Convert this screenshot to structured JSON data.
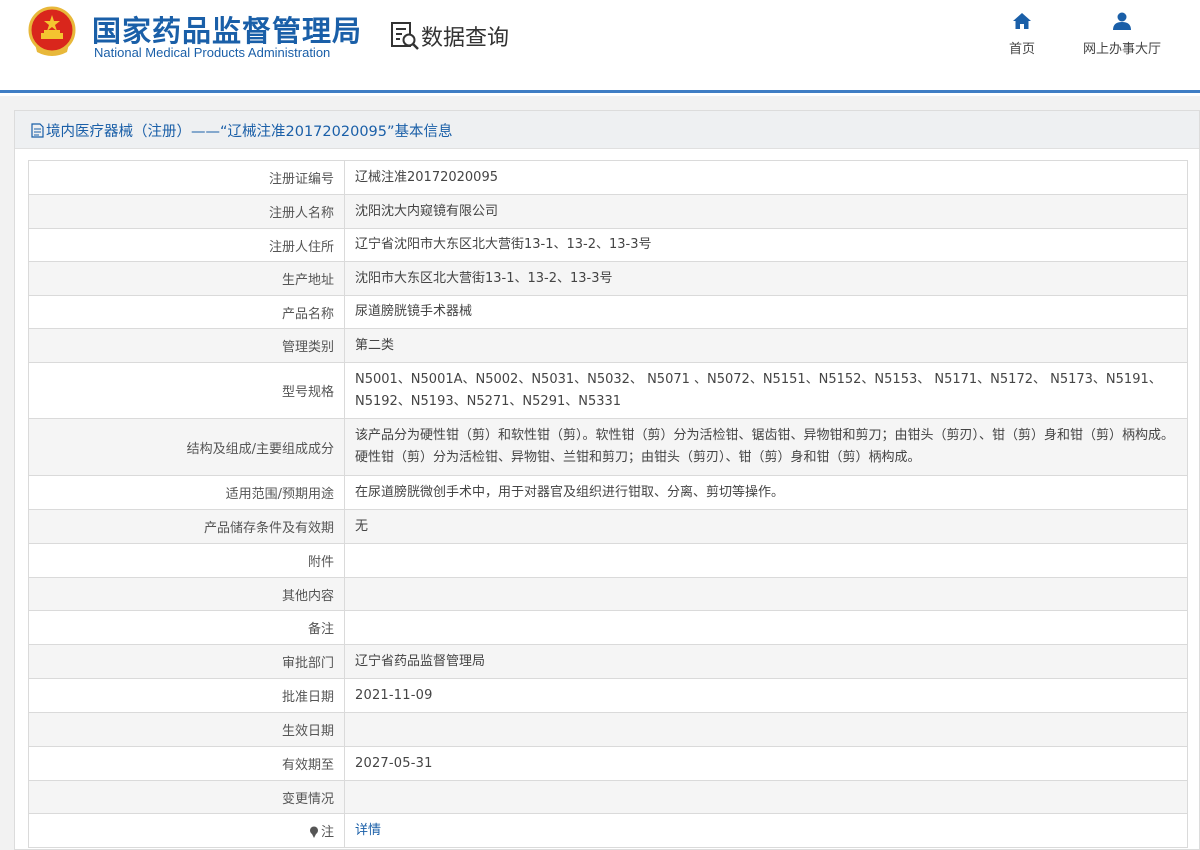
{
  "header": {
    "brand_cn": "国家药品监督管理局",
    "brand_en": "National Medical Products Administration",
    "section_title": "数据查询",
    "nav": [
      {
        "label": "首页",
        "icon": "home-icon"
      },
      {
        "label": "网上办事大厅",
        "icon": "user-icon"
      }
    ]
  },
  "colors": {
    "brand": "#1a5fa8",
    "divider": "#3f7dc4",
    "label_bg": "#fafafa"
  },
  "panel": {
    "title": "境内医疗器械（注册）——“辽械注准20172020095”基本信息"
  },
  "rows": [
    {
      "label": "注册证编号",
      "value": "辽械注准20172020095"
    },
    {
      "label": "注册人名称",
      "value": "沈阳沈大内窥镜有限公司"
    },
    {
      "label": "注册人住所",
      "value": "辽宁省沈阳市大东区北大营街13-1、13-2、13-3号"
    },
    {
      "label": "生产地址",
      "value": "沈阳市大东区北大营街13-1、13-2、13-3号"
    },
    {
      "label": "产品名称",
      "value": "尿道膀胱镜手术器械"
    },
    {
      "label": "管理类别",
      "value": "第二类"
    },
    {
      "label": "型号规格",
      "value": "N5001、N5001A、N5002、N5031、N5032、 N5071 、N5072、N5151、N5152、N5153、 N5171、N5172、 N5173、N5191、N5192、N5193、N5271、N5291、N5331"
    },
    {
      "label": "结构及组成/主要组成成分",
      "value": "该产品分为硬性钳（剪）和软性钳（剪）。软性钳（剪）分为活检钳、锯齿钳、异物钳和剪刀；由钳头（剪刃）、钳（剪）身和钳（剪）柄构成。硬性钳（剪）分为活检钳、异物钳、兰钳和剪刀；由钳头（剪刃）、钳（剪）身和钳（剪）柄构成。"
    },
    {
      "label": "适用范围/预期用途",
      "value": "在尿道膀胱微创手术中，用于对器官及组织进行钳取、分离、剪切等操作。"
    },
    {
      "label": "产品储存条件及有效期",
      "value": "无"
    },
    {
      "label": "附件",
      "value": ""
    },
    {
      "label": "其他内容",
      "value": ""
    },
    {
      "label": "备注",
      "value": ""
    },
    {
      "label": "审批部门",
      "value": "辽宁省药品监督管理局"
    },
    {
      "label": "批准日期",
      "value": "2021-11-09"
    },
    {
      "label": "生效日期",
      "value": ""
    },
    {
      "label": "有效期至",
      "value": "2027-05-31"
    },
    {
      "label": "变更情况",
      "value": ""
    },
    {
      "label": "注",
      "value": "详情",
      "icon": "pin-icon"
    }
  ]
}
